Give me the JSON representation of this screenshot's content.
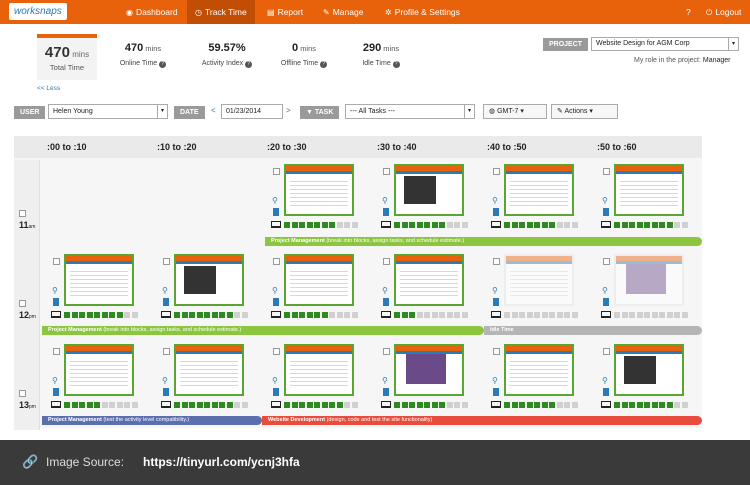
{
  "nav": {
    "brand": "worksnaps",
    "items": [
      {
        "icon": "dashboard-icon",
        "label": "Dashboard",
        "glyph": "◉"
      },
      {
        "icon": "clock-icon",
        "label": "Track Time",
        "glyph": "◷"
      },
      {
        "icon": "chart-icon",
        "label": "Report",
        "glyph": "▤"
      },
      {
        "icon": "wrench-icon",
        "label": "Manage",
        "glyph": "✎"
      },
      {
        "icon": "gear-icon",
        "label": "Profile & Settings",
        "glyph": "✲"
      }
    ],
    "help_glyph": "?",
    "logout_label": "Logout",
    "logout_glyph": "⏻"
  },
  "summary": {
    "total_value": "470",
    "total_unit": "mins",
    "total_label": "Total Time",
    "less_link": "<< Less",
    "stats": [
      {
        "value": "470",
        "unit": "mins",
        "label": "Online Time"
      },
      {
        "value": "59.57%",
        "unit": "",
        "label": "Activity Index"
      },
      {
        "value": "0",
        "unit": "mins",
        "label": "Offline Time"
      },
      {
        "value": "290",
        "unit": "mins",
        "label": "Idle Time"
      }
    ],
    "help_glyph": "?"
  },
  "project": {
    "label": "PROJECT",
    "value": "Website Design for AGM Corp",
    "role_text": "My role in the project:",
    "role_value": "Manager"
  },
  "filters": {
    "user_label": "USER",
    "user_value": "Helen Young",
    "date_label": "DATE",
    "date_value": "01/23/2014",
    "prev": "<",
    "next": ">",
    "task_label": "TASK",
    "task_value": "--- All Tasks ---",
    "timezone": "GMT-7",
    "actions": "Actions",
    "caret": "▾"
  },
  "columns": [
    ":00 to :10",
    ":10 to :20",
    ":20 to :30",
    ":30 to :40",
    ":40 to :50",
    ":50 to :60"
  ],
  "rows": [
    {
      "hour": "11",
      "ampm": "am"
    },
    {
      "hour": "12",
      "ampm": "pm"
    },
    {
      "hour": "13",
      "ampm": "pm"
    }
  ],
  "bands": [
    {
      "row": 0,
      "title": "Project Management",
      "desc": "(break into blocks, assign tasks, and schedule estimate.)",
      "color": "#8cc63f"
    },
    {
      "row": 1,
      "title": "Project Management",
      "desc": "(break into blocks, assign tasks, and schedule estimate.)",
      "color": "#8cc63f"
    },
    {
      "row": 1,
      "title": "Idle Time",
      "desc": "",
      "color": "#b5b5b5"
    },
    {
      "row": 2,
      "title": "Project Management",
      "desc": "(test the activity level compatibility.)",
      "color": "#5b6fae"
    },
    {
      "row": 2,
      "title": "Website Development",
      "desc": "(design, code and test the site functionality)",
      "color": "#e84c3d"
    }
  ],
  "activity": [
    [
      null,
      null,
      7,
      7,
      7,
      8
    ],
    [
      8,
      8,
      6,
      3,
      0,
      0
    ],
    [
      5,
      8,
      8,
      7,
      7,
      8
    ]
  ],
  "footer": {
    "link_glyph": "🔗",
    "source_label": "Image Source:",
    "url": "https://tinyurl.com/ycnj3hfa"
  }
}
